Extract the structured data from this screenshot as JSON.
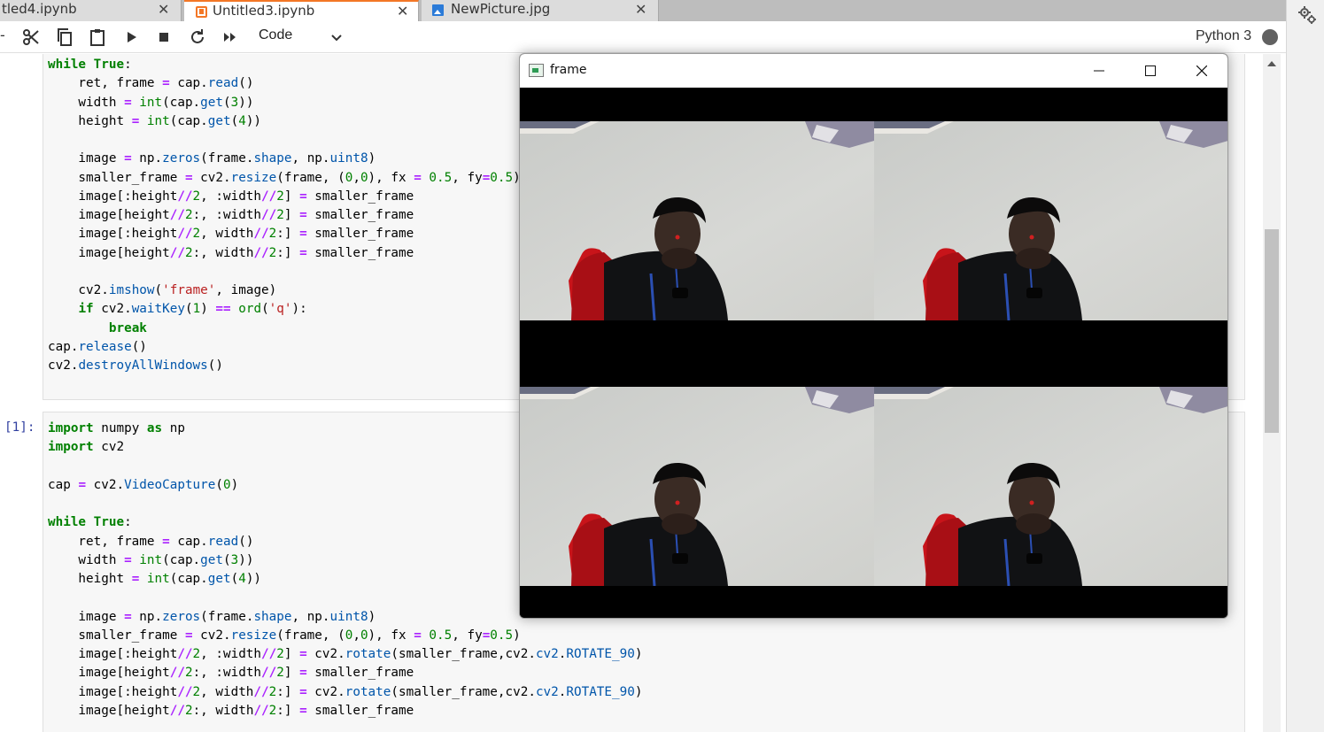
{
  "tabs": [
    {
      "label": "tled4.ipynb",
      "icon": "notebook-icon",
      "active": false
    },
    {
      "label": "Untitled3.ipynb",
      "icon": "notebook-icon",
      "active": true
    },
    {
      "label": "NewPicture.jpg",
      "icon": "image-file-icon",
      "active": false
    }
  ],
  "toolbar": {
    "cell_type": "Code",
    "kernel_name": "Python 3"
  },
  "cells": [
    {
      "prompt": "",
      "code": "top-cell"
    },
    {
      "prompt": "[1]:",
      "code": "bottom-cell"
    }
  ],
  "window": {
    "title": "frame"
  },
  "colors": {
    "accent": "#f37726",
    "keyword": "#008000",
    "operator": "#aa22ff",
    "string": "#ba2121",
    "prompt": "#303f9f"
  }
}
